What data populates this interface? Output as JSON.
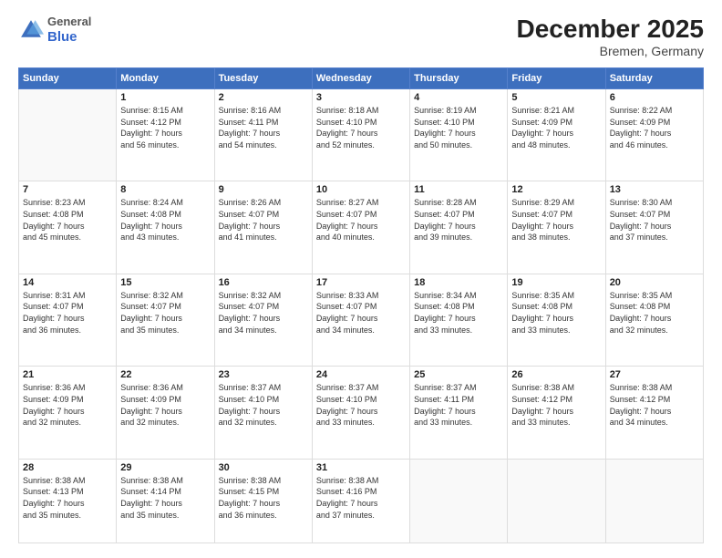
{
  "header": {
    "logo_general": "General",
    "logo_blue": "Blue",
    "title": "December 2025",
    "subtitle": "Bremen, Germany"
  },
  "days_of_week": [
    "Sunday",
    "Monday",
    "Tuesday",
    "Wednesday",
    "Thursday",
    "Friday",
    "Saturday"
  ],
  "weeks": [
    [
      {
        "day": "",
        "info": []
      },
      {
        "day": "1",
        "info": [
          "Sunrise: 8:15 AM",
          "Sunset: 4:12 PM",
          "Daylight: 7 hours",
          "and 56 minutes."
        ]
      },
      {
        "day": "2",
        "info": [
          "Sunrise: 8:16 AM",
          "Sunset: 4:11 PM",
          "Daylight: 7 hours",
          "and 54 minutes."
        ]
      },
      {
        "day": "3",
        "info": [
          "Sunrise: 8:18 AM",
          "Sunset: 4:10 PM",
          "Daylight: 7 hours",
          "and 52 minutes."
        ]
      },
      {
        "day": "4",
        "info": [
          "Sunrise: 8:19 AM",
          "Sunset: 4:10 PM",
          "Daylight: 7 hours",
          "and 50 minutes."
        ]
      },
      {
        "day": "5",
        "info": [
          "Sunrise: 8:21 AM",
          "Sunset: 4:09 PM",
          "Daylight: 7 hours",
          "and 48 minutes."
        ]
      },
      {
        "day": "6",
        "info": [
          "Sunrise: 8:22 AM",
          "Sunset: 4:09 PM",
          "Daylight: 7 hours",
          "and 46 minutes."
        ]
      }
    ],
    [
      {
        "day": "7",
        "info": [
          "Sunrise: 8:23 AM",
          "Sunset: 4:08 PM",
          "Daylight: 7 hours",
          "and 45 minutes."
        ]
      },
      {
        "day": "8",
        "info": [
          "Sunrise: 8:24 AM",
          "Sunset: 4:08 PM",
          "Daylight: 7 hours",
          "and 43 minutes."
        ]
      },
      {
        "day": "9",
        "info": [
          "Sunrise: 8:26 AM",
          "Sunset: 4:07 PM",
          "Daylight: 7 hours",
          "and 41 minutes."
        ]
      },
      {
        "day": "10",
        "info": [
          "Sunrise: 8:27 AM",
          "Sunset: 4:07 PM",
          "Daylight: 7 hours",
          "and 40 minutes."
        ]
      },
      {
        "day": "11",
        "info": [
          "Sunrise: 8:28 AM",
          "Sunset: 4:07 PM",
          "Daylight: 7 hours",
          "and 39 minutes."
        ]
      },
      {
        "day": "12",
        "info": [
          "Sunrise: 8:29 AM",
          "Sunset: 4:07 PM",
          "Daylight: 7 hours",
          "and 38 minutes."
        ]
      },
      {
        "day": "13",
        "info": [
          "Sunrise: 8:30 AM",
          "Sunset: 4:07 PM",
          "Daylight: 7 hours",
          "and 37 minutes."
        ]
      }
    ],
    [
      {
        "day": "14",
        "info": [
          "Sunrise: 8:31 AM",
          "Sunset: 4:07 PM",
          "Daylight: 7 hours",
          "and 36 minutes."
        ]
      },
      {
        "day": "15",
        "info": [
          "Sunrise: 8:32 AM",
          "Sunset: 4:07 PM",
          "Daylight: 7 hours",
          "and 35 minutes."
        ]
      },
      {
        "day": "16",
        "info": [
          "Sunrise: 8:32 AM",
          "Sunset: 4:07 PM",
          "Daylight: 7 hours",
          "and 34 minutes."
        ]
      },
      {
        "day": "17",
        "info": [
          "Sunrise: 8:33 AM",
          "Sunset: 4:07 PM",
          "Daylight: 7 hours",
          "and 34 minutes."
        ]
      },
      {
        "day": "18",
        "info": [
          "Sunrise: 8:34 AM",
          "Sunset: 4:08 PM",
          "Daylight: 7 hours",
          "and 33 minutes."
        ]
      },
      {
        "day": "19",
        "info": [
          "Sunrise: 8:35 AM",
          "Sunset: 4:08 PM",
          "Daylight: 7 hours",
          "and 33 minutes."
        ]
      },
      {
        "day": "20",
        "info": [
          "Sunrise: 8:35 AM",
          "Sunset: 4:08 PM",
          "Daylight: 7 hours",
          "and 32 minutes."
        ]
      }
    ],
    [
      {
        "day": "21",
        "info": [
          "Sunrise: 8:36 AM",
          "Sunset: 4:09 PM",
          "Daylight: 7 hours",
          "and 32 minutes."
        ]
      },
      {
        "day": "22",
        "info": [
          "Sunrise: 8:36 AM",
          "Sunset: 4:09 PM",
          "Daylight: 7 hours",
          "and 32 minutes."
        ]
      },
      {
        "day": "23",
        "info": [
          "Sunrise: 8:37 AM",
          "Sunset: 4:10 PM",
          "Daylight: 7 hours",
          "and 32 minutes."
        ]
      },
      {
        "day": "24",
        "info": [
          "Sunrise: 8:37 AM",
          "Sunset: 4:10 PM",
          "Daylight: 7 hours",
          "and 33 minutes."
        ]
      },
      {
        "day": "25",
        "info": [
          "Sunrise: 8:37 AM",
          "Sunset: 4:11 PM",
          "Daylight: 7 hours",
          "and 33 minutes."
        ]
      },
      {
        "day": "26",
        "info": [
          "Sunrise: 8:38 AM",
          "Sunset: 4:12 PM",
          "Daylight: 7 hours",
          "and 33 minutes."
        ]
      },
      {
        "day": "27",
        "info": [
          "Sunrise: 8:38 AM",
          "Sunset: 4:12 PM",
          "Daylight: 7 hours",
          "and 34 minutes."
        ]
      }
    ],
    [
      {
        "day": "28",
        "info": [
          "Sunrise: 8:38 AM",
          "Sunset: 4:13 PM",
          "Daylight: 7 hours",
          "and 35 minutes."
        ]
      },
      {
        "day": "29",
        "info": [
          "Sunrise: 8:38 AM",
          "Sunset: 4:14 PM",
          "Daylight: 7 hours",
          "and 35 minutes."
        ]
      },
      {
        "day": "30",
        "info": [
          "Sunrise: 8:38 AM",
          "Sunset: 4:15 PM",
          "Daylight: 7 hours",
          "and 36 minutes."
        ]
      },
      {
        "day": "31",
        "info": [
          "Sunrise: 8:38 AM",
          "Sunset: 4:16 PM",
          "Daylight: 7 hours",
          "and 37 minutes."
        ]
      },
      {
        "day": "",
        "info": []
      },
      {
        "day": "",
        "info": []
      },
      {
        "day": "",
        "info": []
      }
    ]
  ]
}
